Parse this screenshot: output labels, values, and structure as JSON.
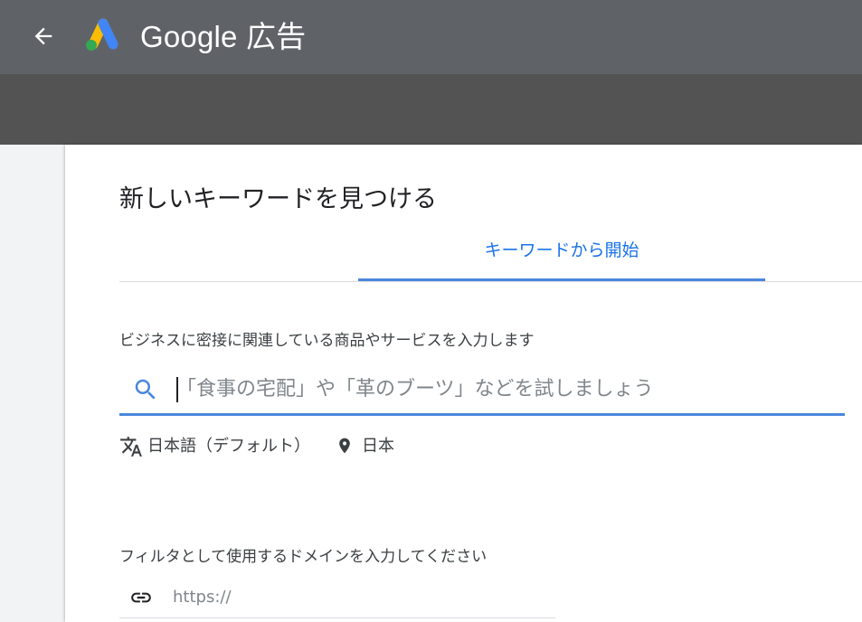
{
  "header": {
    "brand": "Google 広告",
    "back_icon": "arrow-left-icon",
    "logo_icon": "google-ads-logo"
  },
  "card": {
    "title": "新しいキーワードを見つける",
    "tabs": [
      {
        "label": "キーワードから開始",
        "selected": true
      }
    ],
    "keywords": {
      "prompt": "ビジネスに密接に関連している商品やサービスを入力します",
      "placeholder": "「食事の宅配」や「革のブーツ」などを試しましょう",
      "value": "",
      "icon": "search-icon"
    },
    "language": {
      "label": "日本語（デフォルト）",
      "icon": "translate-icon"
    },
    "location": {
      "label": "日本",
      "icon": "location-pin-icon"
    },
    "domain": {
      "prompt": "フィルタとして使用するドメインを入力してください",
      "placeholder": "https://",
      "value": "",
      "icon": "link-icon"
    }
  },
  "colors": {
    "topbar": "#5f6368",
    "subbar": "#535353",
    "accent": "#1a73e8",
    "underline": "#4a87dd",
    "text": "#202124",
    "muted": "#80868b"
  }
}
